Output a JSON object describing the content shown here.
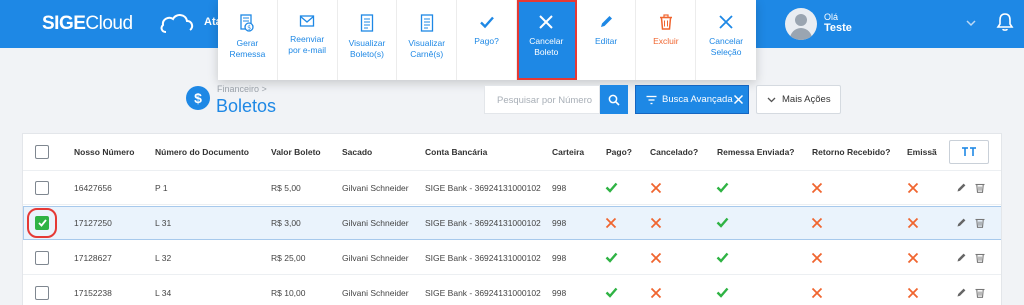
{
  "app": {
    "logo_primary": "SIGE",
    "logo_secondary": "Cloud",
    "nav_fragment": "Ata",
    "greeting": "Olá",
    "user_name": "Teste"
  },
  "toolbar": {
    "actions": [
      {
        "label": "Gerar\nRemessa",
        "icon": "file-money-icon"
      },
      {
        "label": "Reenviar\npor e-mail",
        "icon": "envelope-icon"
      },
      {
        "label": "Visualizar\nBoleto(s)",
        "icon": "document-icon"
      },
      {
        "label": "Visualizar\nCarnê(s)",
        "icon": "document-icon"
      },
      {
        "label": "Pago?",
        "icon": "check-icon"
      },
      {
        "label": "Cancelar\nBoleto",
        "icon": "close-icon"
      },
      {
        "label": "Editar",
        "icon": "pencil-icon"
      },
      {
        "label": "Excluir",
        "icon": "trash-icon"
      },
      {
        "label": "Cancelar\nSeleção",
        "icon": "close-icon"
      }
    ]
  },
  "page": {
    "breadcrumb": "Financeiro",
    "breadcrumb_separator": ">",
    "title": "Boletos",
    "title_icon_glyph": "$"
  },
  "search": {
    "placeholder": "Pesquisar por Número",
    "advanced_label": "Busca Avançada",
    "more_actions_label": "Mais Ações"
  },
  "table": {
    "columns": [
      "Nosso Número",
      "Número do Documento",
      "Valor Boleto",
      "Sacado",
      "Conta Bancária",
      "Carteira",
      "Pago?",
      "Cancelado?",
      "Remessa Enviada?",
      "Retorno Recebido?",
      "Emissã"
    ],
    "rows": [
      {
        "nosso_numero": "16427656",
        "documento": "P 1",
        "valor": "R$ 5,00",
        "sacado": "Gilvani Schneider",
        "conta": "SIGE Bank - 36924131000102",
        "carteira": "998",
        "pago": true,
        "cancelado": false,
        "remessa": true,
        "retorno": false,
        "emissao": false,
        "selected": false
      },
      {
        "nosso_numero": "17127250",
        "documento": "L 31",
        "valor": "R$ 3,00",
        "sacado": "Gilvani Schneider",
        "conta": "SIGE Bank - 36924131000102",
        "carteira": "998",
        "pago": false,
        "cancelado": false,
        "remessa": true,
        "retorno": false,
        "emissao": false,
        "selected": true
      },
      {
        "nosso_numero": "17128627",
        "documento": "L 32",
        "valor": "R$ 25,00",
        "sacado": "Gilvani Schneider",
        "conta": "SIGE Bank - 36924131000102",
        "carteira": "998",
        "pago": true,
        "cancelado": false,
        "remessa": true,
        "retorno": false,
        "emissao": false,
        "selected": false
      },
      {
        "nosso_numero": "17152238",
        "documento": "L 34",
        "valor": "R$ 10,00",
        "sacado": "Gilvani Schneider",
        "conta": "SIGE Bank - 36924131000102",
        "carteira": "998",
        "pago": true,
        "cancelado": false,
        "remessa": true,
        "retorno": false,
        "emissao": false,
        "selected": false
      }
    ]
  },
  "colors": {
    "primary": "#1e88e5",
    "success": "#2fb344",
    "danger_x": "#f0652f",
    "highlight": "#e53935"
  }
}
